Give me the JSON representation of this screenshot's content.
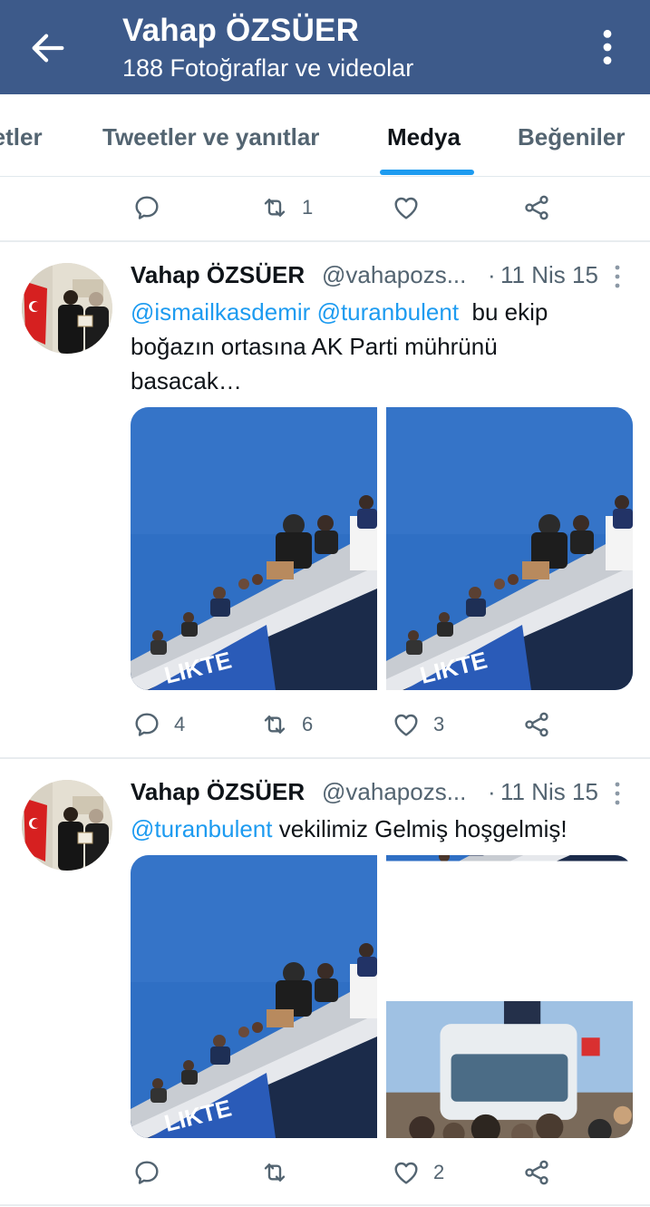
{
  "header": {
    "title": "Vahap ÖZSÜER",
    "subtitle": "188 Fotoğraflar ve videolar"
  },
  "tabs": [
    {
      "label": "Tweetler"
    },
    {
      "label": "Tweetler ve yanıtlar"
    },
    {
      "label": "Medya",
      "active": true
    },
    {
      "label": "Beğeniler"
    }
  ],
  "top_actions": {
    "reply_count": "",
    "retweet_count": "1",
    "like_count": ""
  },
  "tweets": [
    {
      "name": "Vahap ÖZSÜER",
      "handle": "@vahapozs...",
      "dot": "·",
      "date": "11 Nis 15",
      "mention1": "@ismailkasdemir",
      "mention2": "@turanbulent",
      "text_line1_rest": "  bu ekip",
      "text_line2": "boğazın ortasına AK Parti mührünü",
      "text_line3": "basacak…",
      "reply_count": "4",
      "retweet_count": "6",
      "like_count": "3"
    },
    {
      "name": "Vahap ÖZSÜER",
      "handle": "@vahapozs...",
      "dot": "·",
      "date": "11 Nis 15",
      "mention1": "@turanbulent",
      "text_rest": " vekilimiz Gelmiş hoşgelmiş!",
      "reply_count": "",
      "retweet_count": "",
      "like_count": "2"
    }
  ],
  "colors": {
    "header_bg": "#3d5a8a",
    "accent": "#1d9bf0",
    "secondary_text": "#536471",
    "sky": "#2f6fc4"
  },
  "icons": [
    "back-arrow-icon",
    "more-vertical-icon",
    "reply-icon",
    "retweet-icon",
    "like-icon",
    "share-icon"
  ]
}
